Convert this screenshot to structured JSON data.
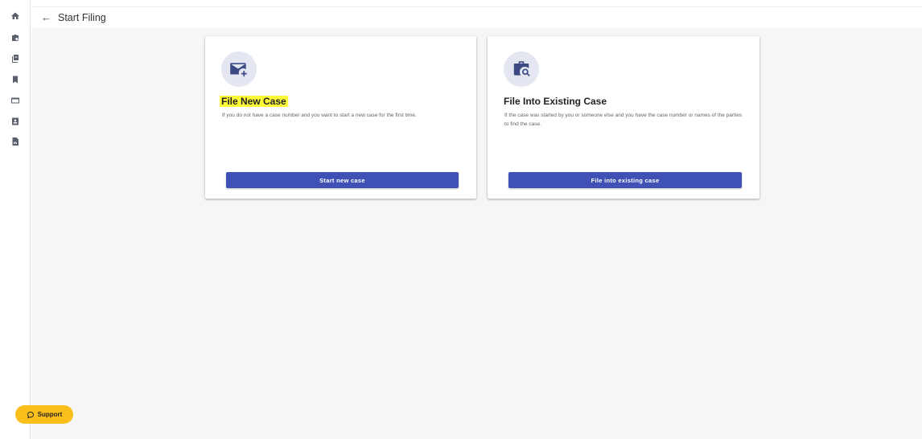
{
  "header": {
    "back_icon": "←",
    "title": "Start Filing"
  },
  "sidebar": {
    "items": [
      {
        "icon": "home-icon"
      },
      {
        "icon": "case-search-icon"
      },
      {
        "icon": "copy-document-icon"
      },
      {
        "icon": "bookmark-icon"
      },
      {
        "icon": "card-icon"
      },
      {
        "icon": "contact-icon"
      },
      {
        "icon": "report-icon"
      }
    ]
  },
  "cards": {
    "new_case": {
      "icon": "mail-add-icon",
      "title": "File New Case",
      "description": "If you do not have a case number and you want to start a new case for the first time.",
      "button": "Start new case"
    },
    "existing_case": {
      "icon": "briefcase-search-icon",
      "title": "File Into Existing Case",
      "description": "If the case was started by you or someone else and you have the case number or names of the parties to find the case.",
      "button": "File into existing case"
    }
  },
  "support": {
    "label": "Support",
    "icon": "chat-bubble-icon"
  },
  "colors": {
    "primary": "#3f51b5",
    "icon_bg": "#e4e6f1",
    "icon_fg": "#3c4a84",
    "support": "#fbbf1c",
    "highlight": "#fdfa37"
  }
}
